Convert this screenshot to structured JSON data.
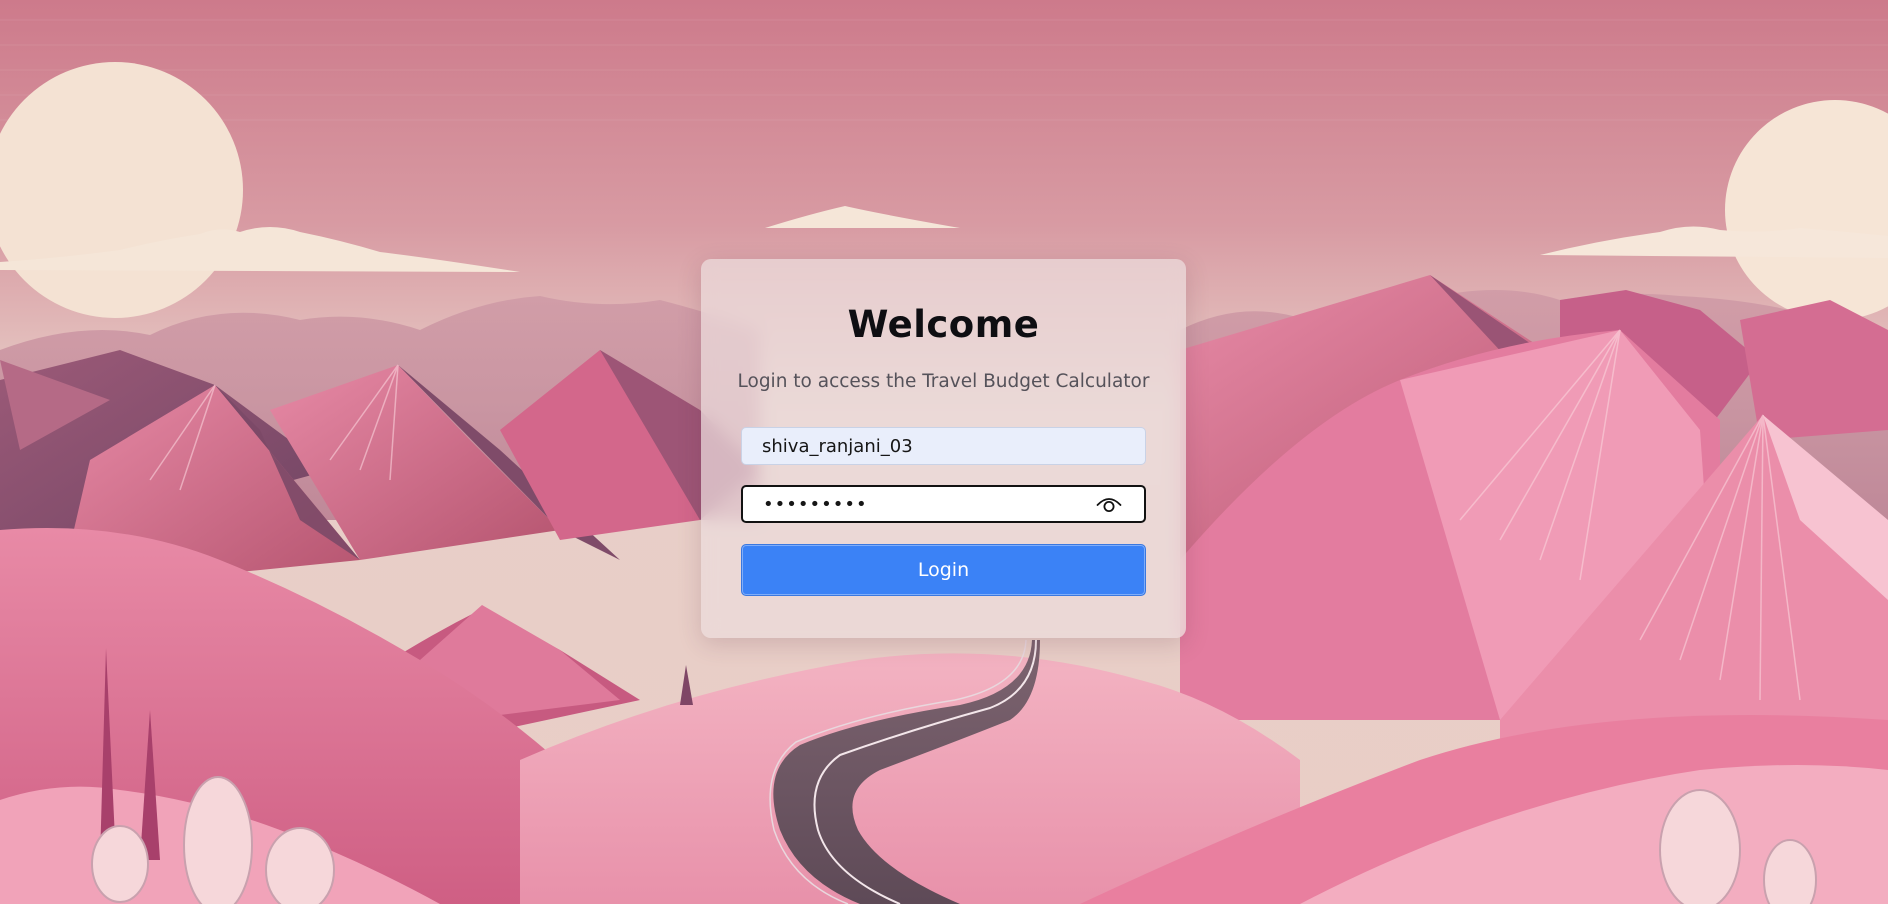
{
  "login": {
    "title": "Welcome",
    "subtitle": "Login to access the Travel Budget Calculator",
    "username_value": "shiva_ranjani_03",
    "password_value": "•••••••••",
    "button_label": "Login",
    "password_toggle_icon": "eye-icon"
  },
  "colors": {
    "sky_top": "#cf8090",
    "sky_bottom": "#e8cfc8",
    "mountain_pink": "#d96a8e",
    "card_background": "#ecdcdc",
    "username_field_fill": "#e9eefb",
    "button_blue": "#3b82f6"
  }
}
